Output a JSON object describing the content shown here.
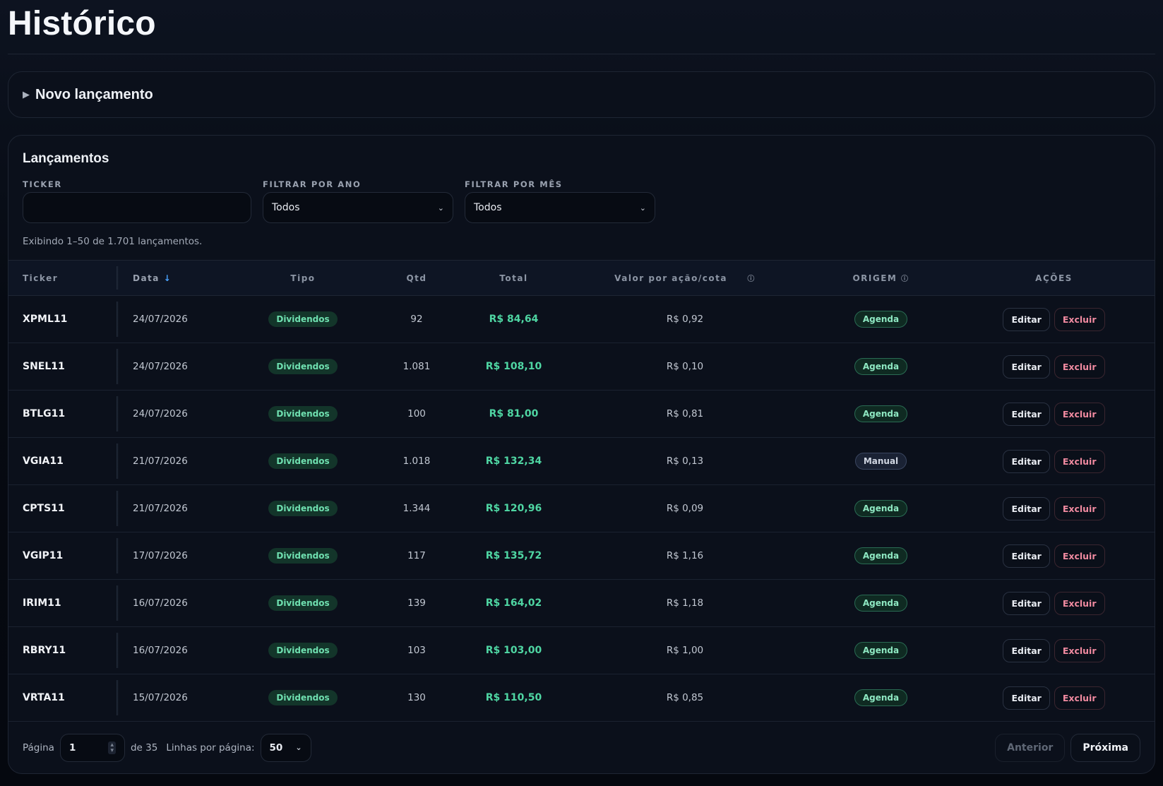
{
  "page": {
    "title": "Histórico"
  },
  "new_entry": {
    "label": "Novo lançamento"
  },
  "entries": {
    "title": "Lançamentos",
    "filters": {
      "ticker_label": "TICKER",
      "ticker_value": "",
      "year_label": "FILTRAR POR ANO",
      "year_value": "Todos",
      "month_label": "FILTRAR POR MÊS",
      "month_value": "Todos"
    },
    "count_text": "Exibindo 1–50 de 1.701 lançamentos.",
    "columns": {
      "ticker": "Ticker",
      "date": "Data",
      "type": "Tipo",
      "qty": "Qtd",
      "total": "Total",
      "value": "Valor por ação/cota",
      "origin": "ORIGEM",
      "actions": "AÇÕES"
    },
    "rows": [
      {
        "ticker": "XPML11",
        "date": "24/07/2026",
        "type": "Dividendos",
        "qty": "92",
        "total": "R$ 84,64",
        "value": "R$ 0,92",
        "origin": "Agenda"
      },
      {
        "ticker": "SNEL11",
        "date": "24/07/2026",
        "type": "Dividendos",
        "qty": "1.081",
        "total": "R$ 108,10",
        "value": "R$ 0,10",
        "origin": "Agenda"
      },
      {
        "ticker": "BTLG11",
        "date": "24/07/2026",
        "type": "Dividendos",
        "qty": "100",
        "total": "R$ 81,00",
        "value": "R$ 0,81",
        "origin": "Agenda"
      },
      {
        "ticker": "VGIA11",
        "date": "21/07/2026",
        "type": "Dividendos",
        "qty": "1.018",
        "total": "R$ 132,34",
        "value": "R$ 0,13",
        "origin": "Manual"
      },
      {
        "ticker": "CPTS11",
        "date": "21/07/2026",
        "type": "Dividendos",
        "qty": "1.344",
        "total": "R$ 120,96",
        "value": "R$ 0,09",
        "origin": "Agenda"
      },
      {
        "ticker": "VGIP11",
        "date": "17/07/2026",
        "type": "Dividendos",
        "qty": "117",
        "total": "R$ 135,72",
        "value": "R$ 1,16",
        "origin": "Agenda"
      },
      {
        "ticker": "IRIM11",
        "date": "16/07/2026",
        "type": "Dividendos",
        "qty": "139",
        "total": "R$ 164,02",
        "value": "R$ 1,18",
        "origin": "Agenda"
      },
      {
        "ticker": "RBRY11",
        "date": "16/07/2026",
        "type": "Dividendos",
        "qty": "103",
        "total": "R$ 103,00",
        "value": "R$ 1,00",
        "origin": "Agenda"
      },
      {
        "ticker": "VRTA11",
        "date": "15/07/2026",
        "type": "Dividendos",
        "qty": "130",
        "total": "R$ 110,50",
        "value": "R$ 0,85",
        "origin": "Agenda"
      }
    ],
    "actions": {
      "edit": "Editar",
      "delete": "Excluir"
    }
  },
  "pagination": {
    "page_label": "Página",
    "page_value": "1",
    "of_text": "de 35",
    "rows_label": "Linhas por página:",
    "rows_value": "50",
    "prev": "Anterior",
    "next": "Próxima"
  },
  "colors": {
    "background": "#05080f",
    "card": "#0b101b",
    "accent_green": "#4fd6a3",
    "danger": "#f08aa0",
    "sort_arrow": "#4aa3ff"
  }
}
